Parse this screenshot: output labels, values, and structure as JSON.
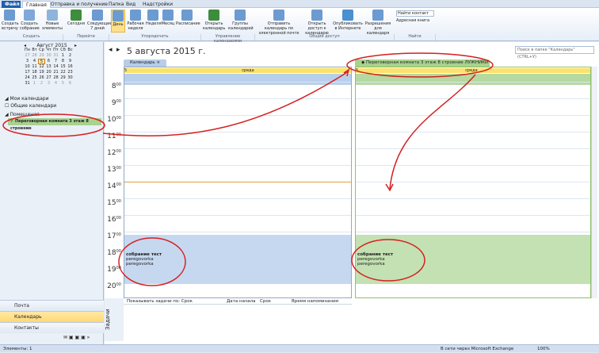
{
  "tabs": [
    "Файл",
    "Главная",
    "Отправка и получение",
    "Папка",
    "Вид",
    "Надстройки"
  ],
  "ribbon": {
    "buttons": [
      "Создать встречу",
      "Создать собрание",
      "Новые элементы",
      "Сегодня",
      "Следующие 7 дней",
      "День",
      "Рабочая неделя",
      "Неделя",
      "Месяц",
      "Расписание",
      "Открыть календарь",
      "Группы календарей",
      "Отправить календарь по электронной почте",
      "Открыть доступ к календарю",
      "Опубликовать в Интернете",
      "Разрешения для календаря"
    ],
    "groups": [
      "Создать",
      "Перейти",
      "Упорядочить",
      "Управление календарями",
      "Общий доступ",
      "Найти"
    ],
    "find": [
      "Найти контакт",
      "Адресная книга"
    ]
  },
  "mini_calendar": {
    "title": "Август 2015",
    "weekdays": [
      "Пн",
      "Вт",
      "Ср",
      "Чт",
      "Пт",
      "Сб",
      "Вс"
    ],
    "weeks": [
      [
        "27",
        "28",
        "29",
        "30",
        "31",
        "1",
        "2"
      ],
      [
        "3",
        "4",
        "5",
        "6",
        "7",
        "8",
        "9"
      ],
      [
        "10",
        "11",
        "12",
        "13",
        "14",
        "15",
        "16"
      ],
      [
        "17",
        "18",
        "19",
        "20",
        "21",
        "22",
        "23"
      ],
      [
        "24",
        "25",
        "26",
        "27",
        "28",
        "29",
        "30"
      ],
      [
        "31",
        "1",
        "2",
        "3",
        "4",
        "5",
        "6"
      ]
    ]
  },
  "nav": {
    "my_calendars": "Мои календари",
    "shared": "Общие календари",
    "rooms": "Помещения",
    "room_item": "Переговорная комната 3 этаж 8 строение",
    "mail": "Почта",
    "calendar": "Календарь",
    "contacts": "Контакты"
  },
  "main": {
    "date": "5 августа 2015 г.",
    "search_placeholder": "Поиск в папке \"Календарь\" (CTRL+У)",
    "tab1": "Календарь",
    "tab2": "Переговорная комната 3 этаж 8 строение ЛУЖНИКИ",
    "day_num": "5",
    "day_name": "среда",
    "hours": [
      "8",
      "9",
      "10",
      "11",
      "12",
      "13",
      "14",
      "15",
      "16",
      "17",
      "18",
      "19",
      "20"
    ],
    "minutes": "00",
    "appointment": {
      "title": "собрание тест",
      "line1": "peregovorka",
      "line2": "peregovorka"
    }
  },
  "tasks": {
    "label": "Задачи",
    "show_by": "Показывать задачи по: Срок",
    "start": "Дата начала",
    "due": "Срок",
    "reminder": "Время напоминания"
  },
  "status": {
    "items": "Элементы: 1",
    "exchange": "В сети через Microsoft Exchange",
    "zoom": "100%"
  }
}
